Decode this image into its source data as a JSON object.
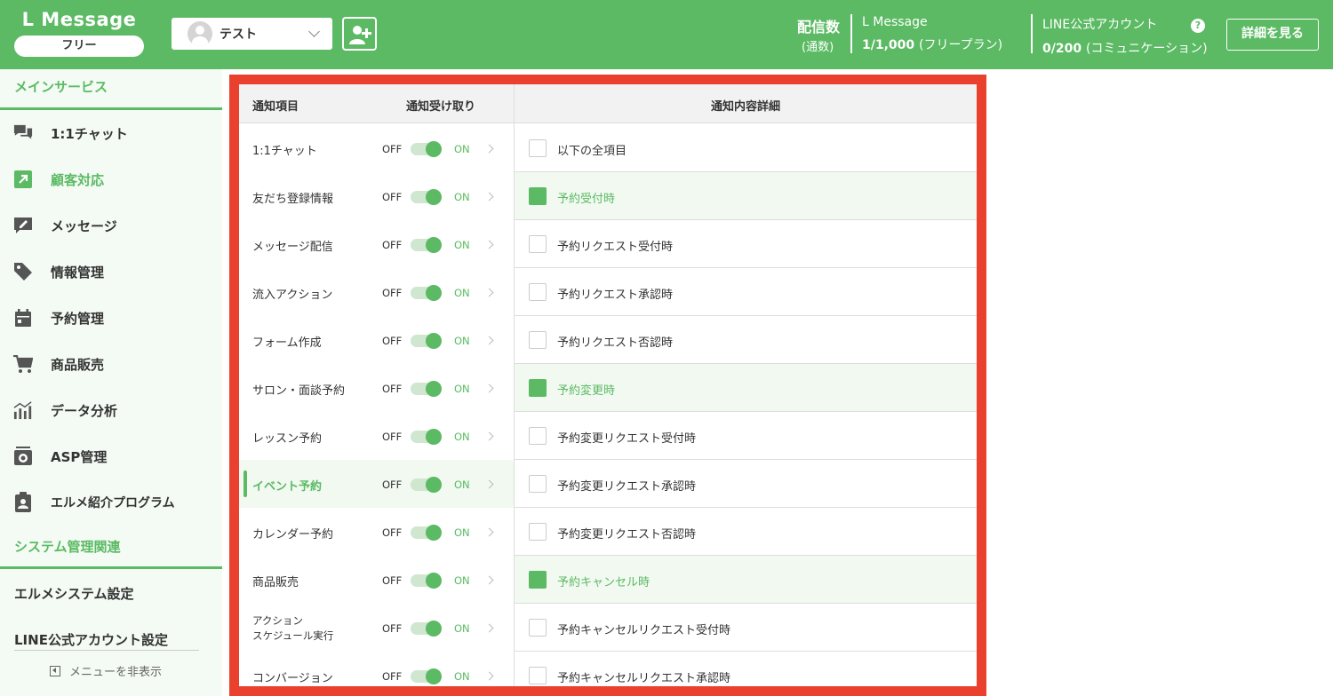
{
  "header": {
    "brand": "L Message",
    "plan": "フリー",
    "account_name": "テスト",
    "stat_label": "配信数",
    "stat_sub": "(通数)",
    "lmsg_title": "L Message",
    "lmsg_value": "1/1,000",
    "lmsg_plan": "(フリープラン)",
    "line_title": "LINE公式アカウント",
    "line_value": "0/200",
    "line_plan": "(コミュニケーション)",
    "help": "?",
    "detail_button": "詳細を見る",
    "accent_color": "#5bba63"
  },
  "sidebar": {
    "main_section": "メインサービス",
    "items": [
      {
        "label": "1:1チャット",
        "icon": "chat-bubbles-icon"
      },
      {
        "label": "顧客対応",
        "icon": "arrow-up-right-icon",
        "active": true
      },
      {
        "label": "メッセージ",
        "icon": "message-edit-icon"
      },
      {
        "label": "情報管理",
        "icon": "tag-icon"
      },
      {
        "label": "予約管理",
        "icon": "calendar-icon"
      },
      {
        "label": "商品販売",
        "icon": "cart-icon"
      },
      {
        "label": "データ分析",
        "icon": "chart-icon"
      },
      {
        "label": "ASP管理",
        "icon": "asp-icon"
      },
      {
        "label": "エルメ紹介プログラム",
        "icon": "clipboard-badge-icon"
      }
    ],
    "system_section": "システム管理関連",
    "system_settings": "エルメシステム設定",
    "line_settings": "LINE公式アカウント設定",
    "hide_menu": "メニューを非表示"
  },
  "table": {
    "col_item": "通知項目",
    "col_receive": "通知受け取り",
    "col_detail": "通知内容詳細",
    "off_label": "OFF",
    "on_label": "ON",
    "warning_border_color": "#e9412d",
    "items": [
      {
        "label": "1:1チャット",
        "on": true
      },
      {
        "label": "友だち登録情報",
        "on": true
      },
      {
        "label": "メッセージ配信",
        "on": true
      },
      {
        "label": "流入アクション",
        "on": true
      },
      {
        "label": "フォーム作成",
        "on": true
      },
      {
        "label": "サロン・面談予約",
        "on": true
      },
      {
        "label": "レッスン予約",
        "on": true
      },
      {
        "label": "イベント予約",
        "on": true,
        "selected": true
      },
      {
        "label": "カレンダー予約",
        "on": true
      },
      {
        "label": "商品販売",
        "on": true
      },
      {
        "label_line1": "アクション",
        "label_line2": "スケジュール実行",
        "on": true
      },
      {
        "label": "コンバージョン",
        "on": true
      }
    ],
    "details": [
      {
        "label": "以下の全項目",
        "checked": false
      },
      {
        "label": "予約受付時",
        "checked": true
      },
      {
        "label": "予約リクエスト受付時",
        "checked": false
      },
      {
        "label": "予約リクエスト承認時",
        "checked": false
      },
      {
        "label": "予約リクエスト否認時",
        "checked": false
      },
      {
        "label": "予約変更時",
        "checked": true
      },
      {
        "label": "予約変更リクエスト受付時",
        "checked": false
      },
      {
        "label": "予約変更リクエスト承認時",
        "checked": false
      },
      {
        "label": "予約変更リクエスト否認時",
        "checked": false
      },
      {
        "label": "予約キャンセル時",
        "checked": true
      },
      {
        "label": "予約キャンセルリクエスト受付時",
        "checked": false
      },
      {
        "label": "予約キャンセルリクエスト承認時",
        "checked": false
      }
    ]
  }
}
